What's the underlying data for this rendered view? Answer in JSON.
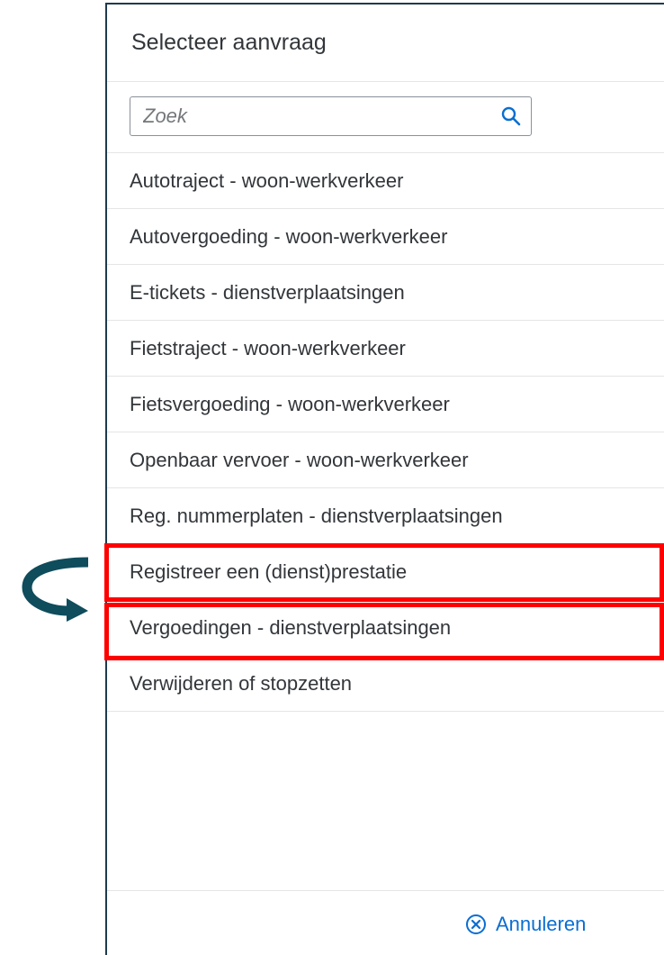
{
  "dialog": {
    "title": "Selecteer aanvraag",
    "search": {
      "placeholder": "Zoek",
      "value": ""
    },
    "items": [
      {
        "label": "Autotraject - woon-werkverkeer"
      },
      {
        "label": "Autovergoeding - woon-werkverkeer"
      },
      {
        "label": "E-tickets - dienstverplaatsingen"
      },
      {
        "label": "Fietstraject - woon-werkverkeer"
      },
      {
        "label": "Fietsvergoeding - woon-werkverkeer"
      },
      {
        "label": "Openbaar vervoer - woon-werkverkeer"
      },
      {
        "label": "Reg. nummerplaten - dienstverplaatsingen"
      },
      {
        "label": "Registreer een (dienst)prestatie"
      },
      {
        "label": "Vergoedingen - dienstverplaatsingen"
      },
      {
        "label": "Verwijderen of stopzetten"
      }
    ],
    "cancel_label": "Annuleren"
  },
  "annotations": {
    "highlight_color": "#ff0000",
    "arrow_color": "#0f4c5c",
    "highlighted_items": [
      "Registreer een (dienst)prestatie",
      "Vergoedingen - dienstverplaatsingen"
    ],
    "arrow_icon": "curved-arrow-icon"
  },
  "colors": {
    "text": "#32363a",
    "link": "#0a6ed1",
    "border": "#e5e5e5",
    "dialog_border": "#1f3a4d"
  }
}
